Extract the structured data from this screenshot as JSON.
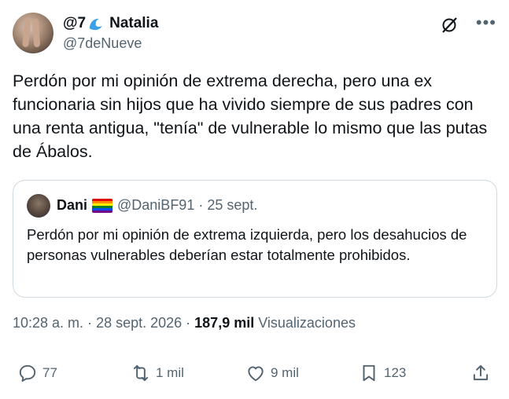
{
  "author": {
    "display_name_prefix": "@7",
    "display_name": "Natalia",
    "handle": "@7deNueve"
  },
  "tweet": {
    "text": "Perdón por mi opinión de extrema derecha, pero una ex funcionaria sin hijos que ha vivido siempre de sus padres con una renta antigua, \"tenía\" de vulnerable lo mismo que las putas de Ábalos."
  },
  "quoted_tweet": {
    "display_name": "Dani",
    "handle": "@DaniBF91",
    "separator": "·",
    "date": "25 sept.",
    "text": "Perdón por mi opinión de extrema izquierda, pero los desahucios de personas vulnerables deberían estar totalmente prohibidos."
  },
  "meta": {
    "time": "10:28 a. m.",
    "dot1": "·",
    "date": "28 sept. 2026",
    "dot2": "·",
    "views_count": "187,9 mil",
    "views_label": "Visualizaciones"
  },
  "actions": {
    "replies": "77",
    "reposts": "1 mil",
    "likes": "9 mil",
    "bookmarks": "123"
  },
  "icons": {
    "grok": "grok-icon",
    "more": "more-icon",
    "reply": "reply-icon",
    "repost": "repost-icon",
    "like": "heart-icon",
    "bookmark": "bookmark-icon",
    "share": "share-icon"
  },
  "colors": {
    "text": "#0f1419",
    "secondary": "#536471",
    "border": "#cfd9de"
  }
}
